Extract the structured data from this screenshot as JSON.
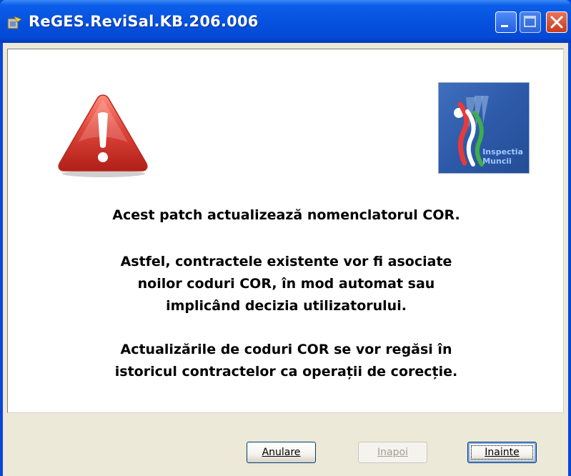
{
  "window": {
    "title": "ReGES.ReviSal.KB.206.006"
  },
  "titlebar_controls": {
    "minimize_icon": "minimize-icon",
    "maximize_icon": "maximize-icon",
    "close_icon": "close-icon"
  },
  "logo": {
    "line1": "Inspectia",
    "line2": "Muncii"
  },
  "message": {
    "p1": "Acest patch actualizează nomenclatorul COR.",
    "p2_l1": "Astfel, contractele existente vor fi asociate",
    "p2_l2": "noilor coduri COR, în mod automat sau",
    "p2_l3": "implicând decizia utilizatorului.",
    "p3_l1": "Actualizările de coduri COR se vor regăsi în",
    "p3_l2": "istoricul contractelor ca operații de corecție."
  },
  "buttons": {
    "cancel_label": "Anulare",
    "back_label": "Inapoi",
    "next_label": "Inainte"
  },
  "colors": {
    "titlebar": "#0552df",
    "dialog_bg": "#ece9d8",
    "warning_red": "#d93a2f"
  }
}
